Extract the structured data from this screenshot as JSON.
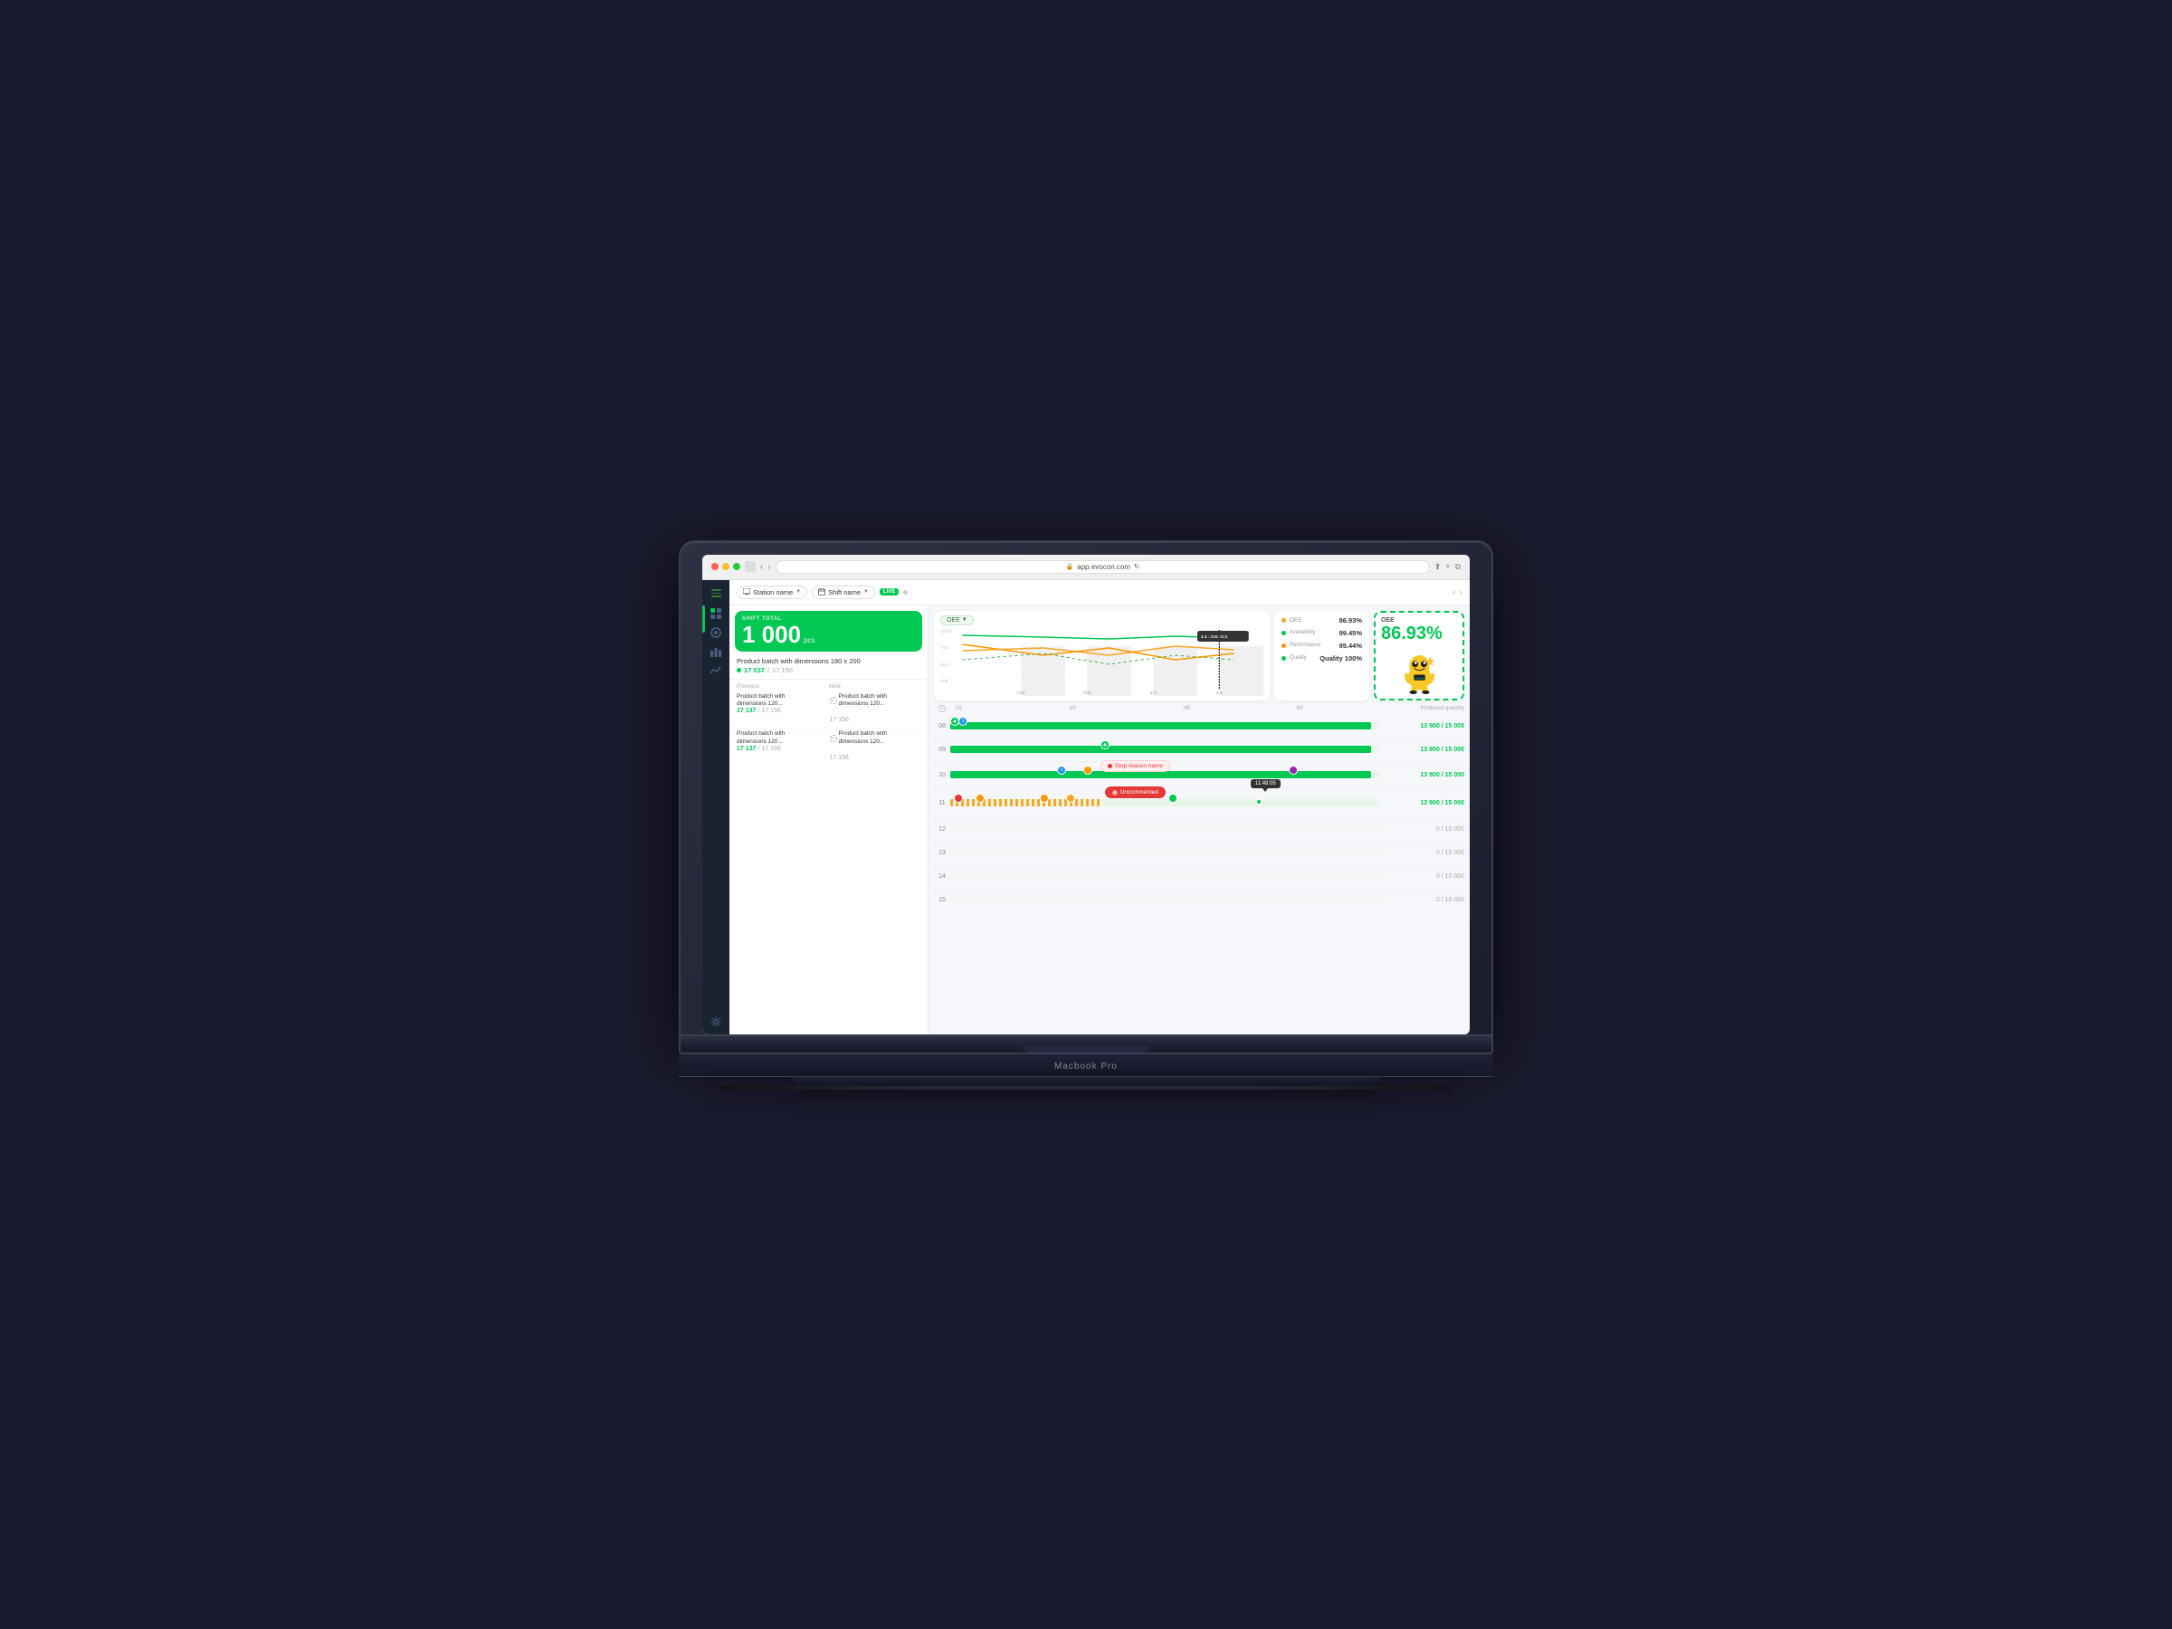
{
  "browser": {
    "url": "app.evocon.com",
    "traffic_lights": [
      "red",
      "yellow",
      "green"
    ]
  },
  "topbar": {
    "station_name": "Station name",
    "shift_name": "Shift name",
    "live_badge": "LIVE"
  },
  "shift": {
    "label": "SHIFT TOTAL",
    "total_number": "1 000",
    "unit": "pcs",
    "product_name": "Product batch with dimensions 180 x 200",
    "count_current": "17 037",
    "count_total": "17 156",
    "prev_label": "Previous",
    "next_label": "Next",
    "batches": [
      {
        "prev_name": "Product batch with dimensions 120...",
        "prev_count": "17 137",
        "prev_total": "17 156",
        "next_name": "Product batch with dimensions 120...",
        "next_count": "17 156"
      },
      {
        "prev_name": "Product batch with dimensions 120...",
        "prev_count": "17 137",
        "prev_total": "17 156",
        "next_name": "Product batch with dimensions 120...",
        "next_count": "17 156"
      }
    ]
  },
  "oee": {
    "tag_label": "OEE",
    "chart_times": [
      "08",
      "09",
      "10",
      "11"
    ],
    "chart_max": 100,
    "oee_label": "OEE",
    "oee_value": "86.93%",
    "stats": [
      {
        "label": "OEE",
        "value": "86.93%",
        "color": "#f9a825"
      },
      {
        "label": "Availability",
        "value": "99.45%",
        "color": "#00c853"
      },
      {
        "label": "Performance",
        "value": "95.44%",
        "color": "#ff9800"
      },
      {
        "label": "Quality",
        "value": "100%",
        "color": "#00c853"
      }
    ]
  },
  "timeline": {
    "header_label": "Produced quantity",
    "time_ticks": [
      ":15",
      ":30",
      ":45",
      "60"
    ],
    "rows": [
      {
        "hour": "08",
        "fill_pct": 98,
        "produced": "13 900 / 15 000",
        "zero": false
      },
      {
        "hour": "09",
        "fill_pct": 98,
        "produced": "13 900 / 15 000",
        "zero": false
      },
      {
        "hour": "10",
        "fill_pct": 98,
        "produced": "13 900 / 15 000",
        "zero": false
      },
      {
        "hour": "11",
        "fill_pct": 60,
        "produced": "13 900 / 15 000",
        "zero": false,
        "dotted": true
      },
      {
        "hour": "12",
        "fill_pct": 0,
        "produced": "0 / 15 000",
        "zero": true
      },
      {
        "hour": "13",
        "fill_pct": 0,
        "produced": "0 / 15 000",
        "zero": true
      },
      {
        "hour": "14",
        "fill_pct": 0,
        "produced": "0 / 15 000",
        "zero": true
      },
      {
        "hour": "15",
        "fill_pct": 0,
        "produced": "0 / 15 000",
        "zero": true
      }
    ],
    "events": {
      "stop_reason": "Stop reason name",
      "uncommented": "Uncommented",
      "timestamp": "11:48:05"
    }
  },
  "quality_badge": "Quality 100%",
  "macbook_label": "Macbook Pro"
}
